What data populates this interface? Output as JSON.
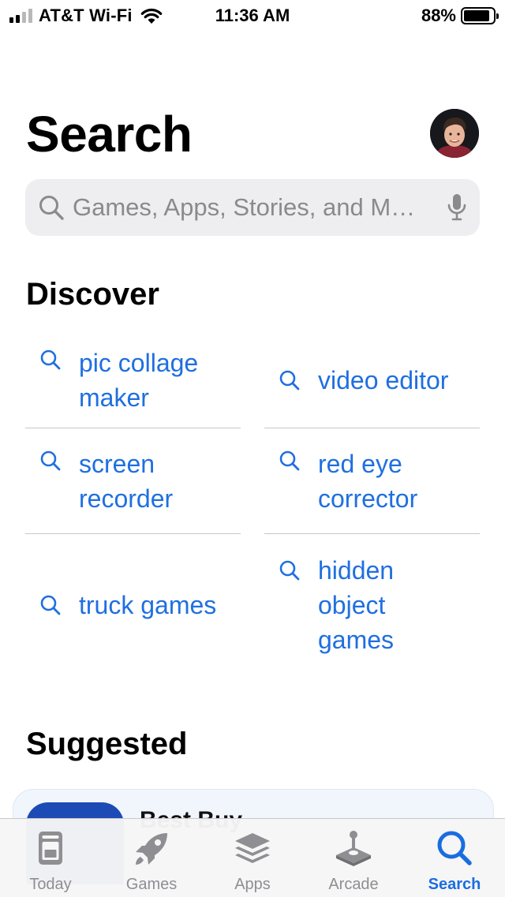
{
  "status_bar": {
    "carrier": "AT&T Wi-Fi",
    "time": "11:36 AM",
    "battery_percent": "88%",
    "battery_level": 0.88,
    "signal_bars": 2
  },
  "header": {
    "title": "Search"
  },
  "search": {
    "placeholder": "Games, Apps, Stories, and M…"
  },
  "discover": {
    "title": "Discover",
    "items": [
      {
        "label": "pic collage maker"
      },
      {
        "label": "video editor"
      },
      {
        "label": "screen recorder"
      },
      {
        "label": "red eye corrector"
      },
      {
        "label": "truck games"
      },
      {
        "label": "hidden object games"
      }
    ]
  },
  "suggested": {
    "title": "Suggested",
    "first_app_name": "Best Buy"
  },
  "tabbar": {
    "tabs": [
      {
        "label": "Today",
        "icon": "today-icon"
      },
      {
        "label": "Games",
        "icon": "rocket-icon"
      },
      {
        "label": "Apps",
        "icon": "apps-stack-icon"
      },
      {
        "label": "Arcade",
        "icon": "joystick-icon"
      },
      {
        "label": "Search",
        "icon": "search-icon"
      }
    ],
    "active": "Search"
  },
  "colors": {
    "accent": "#1f6fe0",
    "inactive_tab": "#8e8e93",
    "search_field_bg": "#eeeef0"
  }
}
